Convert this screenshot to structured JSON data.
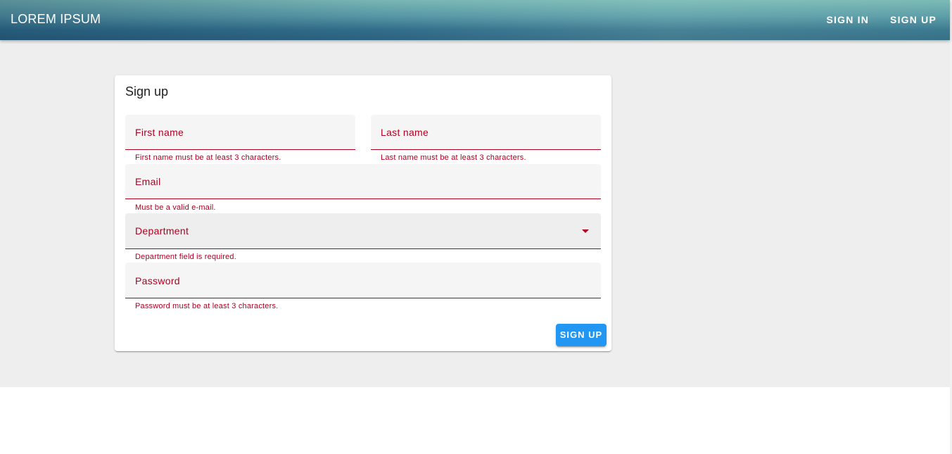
{
  "app": {
    "title": "LOREM IPSUM"
  },
  "nav": {
    "sign_in": "SIGN IN",
    "sign_up": "SIGN UP"
  },
  "form": {
    "title": "Sign up",
    "first_name": {
      "label": "First name",
      "error": "First name must be at least 3 characters.",
      "value": ""
    },
    "last_name": {
      "label": "Last name",
      "error": "Last name must be at least 3 characters.",
      "value": ""
    },
    "email": {
      "label": "Email",
      "error": "Must be a valid e-mail.",
      "value": ""
    },
    "department": {
      "label": "Department",
      "error": "Department field is required.",
      "value": "",
      "icon": "chevron-down-icon"
    },
    "password": {
      "label": "Password",
      "error": "Password must be at least 3 characters.",
      "value": ""
    },
    "submit_label": "SIGN UP"
  },
  "colors": {
    "error": "#b00020",
    "primary_button": "#2196f3",
    "background": "#eeeeee"
  }
}
